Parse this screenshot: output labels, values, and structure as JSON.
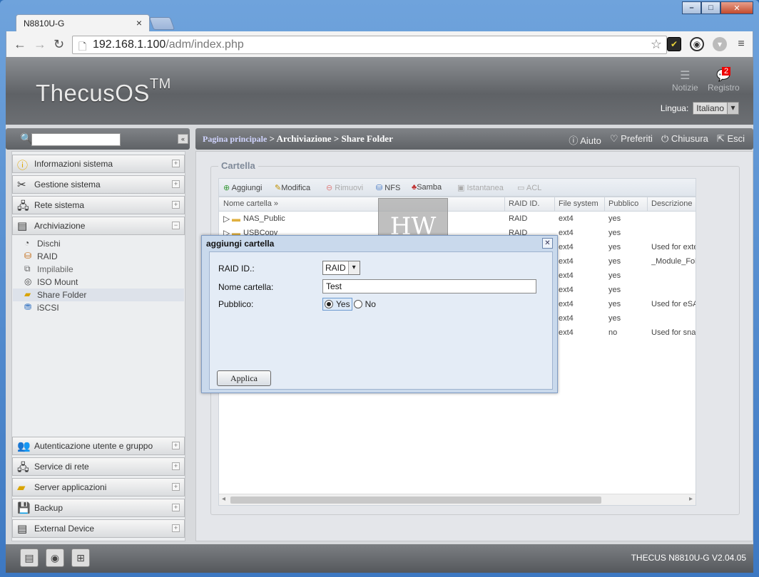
{
  "browser": {
    "tab_title": "N8810U-G",
    "url_host": "192.168.1.100",
    "url_path": "/adm/index.php"
  },
  "header": {
    "logo": "ThecusOS",
    "logo_tm": "TM",
    "notizie": "Notizie",
    "registro": "Registro",
    "registro_badge": "2",
    "lingua_label": "Lingua:",
    "lingua_value": "Italiano"
  },
  "sidebar": {
    "search_placeholder": "",
    "top_items": [
      {
        "label": "Informazioni sistema"
      },
      {
        "label": "Gestione sistema"
      },
      {
        "label": "Rete sistema"
      },
      {
        "label": "Archiviazione"
      }
    ],
    "sub_items": [
      {
        "label": "Dischi"
      },
      {
        "label": "RAID"
      },
      {
        "label": "Impilabile"
      },
      {
        "label": "ISO Mount"
      },
      {
        "label": "Share Folder"
      },
      {
        "label": "iSCSI"
      }
    ],
    "bottom_items": [
      {
        "label": "Autenticazione utente e gruppo"
      },
      {
        "label": "Service di rete"
      },
      {
        "label": "Server applicazioni"
      },
      {
        "label": "Backup"
      },
      {
        "label": "External Device"
      }
    ]
  },
  "breadcrumb": {
    "home": "Pagina principale",
    "sep1": " > ",
    "section": "Archiviazione",
    "sep2": " > ",
    "page": "Share Folder"
  },
  "actions": {
    "aiuto": "Aiuto",
    "preferiti": "Preferiti",
    "chiusura": "Chiusura",
    "esci": "Esci"
  },
  "panel": {
    "legend": "Cartella",
    "toolbar": {
      "aggiungi": "Aggiungi",
      "modifica": "Modifica",
      "rimuovi": "Rimuovi",
      "nfs": "NFS",
      "samba": "Samba",
      "istantanea": "Istantanea",
      "acl": "ACL"
    },
    "columns": {
      "nome": "Nome cartella",
      "raid": "RAID ID.",
      "fs": "File system",
      "pubblico": "Pubblico",
      "descrizione": "Descrizione"
    },
    "rows": [
      {
        "nome": "NAS_Public",
        "raid": "RAID",
        "fs": "ext4",
        "pubblico": "yes",
        "descrizione": ""
      },
      {
        "nome": "USBCopy",
        "raid": "RAID",
        "fs": "ext4",
        "pubblico": "yes",
        "descrizione": ""
      },
      {
        "nome": "",
        "raid": "RAID",
        "fs": "ext4",
        "pubblico": "yes",
        "descrizione": "Used for exte"
      },
      {
        "nome": "",
        "raid": "",
        "fs": "ext4",
        "pubblico": "yes",
        "descrizione": "_Module_Folc"
      },
      {
        "nome": "",
        "raid": "",
        "fs": "ext4",
        "pubblico": "yes",
        "descrizione": ""
      },
      {
        "nome": "",
        "raid": "",
        "fs": "ext4",
        "pubblico": "yes",
        "descrizione": ""
      },
      {
        "nome": "",
        "raid": "",
        "fs": "ext4",
        "pubblico": "yes",
        "descrizione": "Used for eSA"
      },
      {
        "nome": "",
        "raid": "",
        "fs": "ext4",
        "pubblico": "yes",
        "descrizione": ""
      },
      {
        "nome": "",
        "raid": "",
        "fs": "ext4",
        "pubblico": "no",
        "descrizione": "Used for sna"
      }
    ]
  },
  "dialog": {
    "title": "aggiungi cartella",
    "raid_label": "RAID ID.:",
    "raid_value": "RAID",
    "nome_label": "Nome cartella:",
    "nome_value": "Test",
    "pubblico_label": "Pubblico:",
    "yes": "Yes",
    "no": "No",
    "apply": "Applica"
  },
  "footer": {
    "version": "THECUS N8810U-G V2.04.05"
  }
}
